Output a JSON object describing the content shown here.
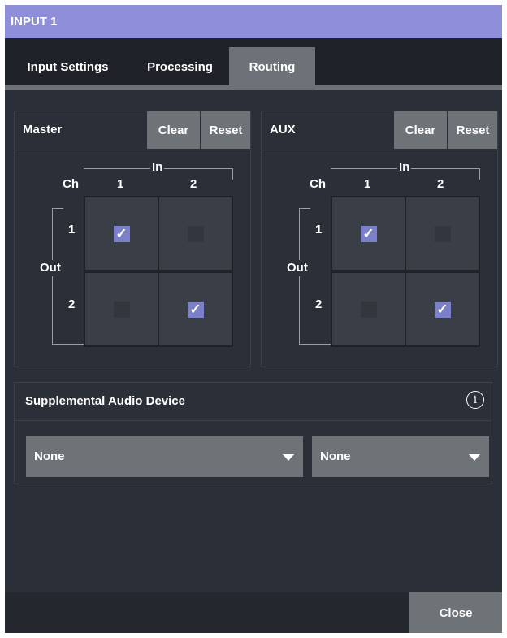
{
  "window": {
    "title": "INPUT 1"
  },
  "tabs": [
    {
      "label": "Input Settings",
      "active": false
    },
    {
      "label": "Processing",
      "active": false
    },
    {
      "label": "Routing",
      "active": true
    }
  ],
  "master": {
    "title": "Master",
    "clear_label": "Clear",
    "reset_label": "Reset",
    "in_label": "In",
    "out_label": "Out",
    "ch_label": "Ch",
    "in_channels": [
      "1",
      "2"
    ],
    "out_channels": [
      "1",
      "2"
    ],
    "routing": [
      [
        true,
        false
      ],
      [
        false,
        true
      ]
    ]
  },
  "aux": {
    "title": "AUX",
    "clear_label": "Clear",
    "reset_label": "Reset",
    "in_label": "In",
    "out_label": "Out",
    "ch_label": "Ch",
    "in_channels": [
      "1",
      "2"
    ],
    "out_channels": [
      "1",
      "2"
    ],
    "routing": [
      [
        true,
        false
      ],
      [
        false,
        true
      ]
    ]
  },
  "supplemental": {
    "title": "Supplemental Audio Device",
    "info_icon": "info-circle",
    "selects": [
      {
        "value": "None"
      },
      {
        "value": "None"
      }
    ]
  },
  "footer": {
    "close_label": "Close"
  },
  "colors": {
    "title_bar": "#8f8fd9",
    "accent_check": "#7b80c9",
    "button": "#6e7378",
    "background": "#2b2f37"
  }
}
